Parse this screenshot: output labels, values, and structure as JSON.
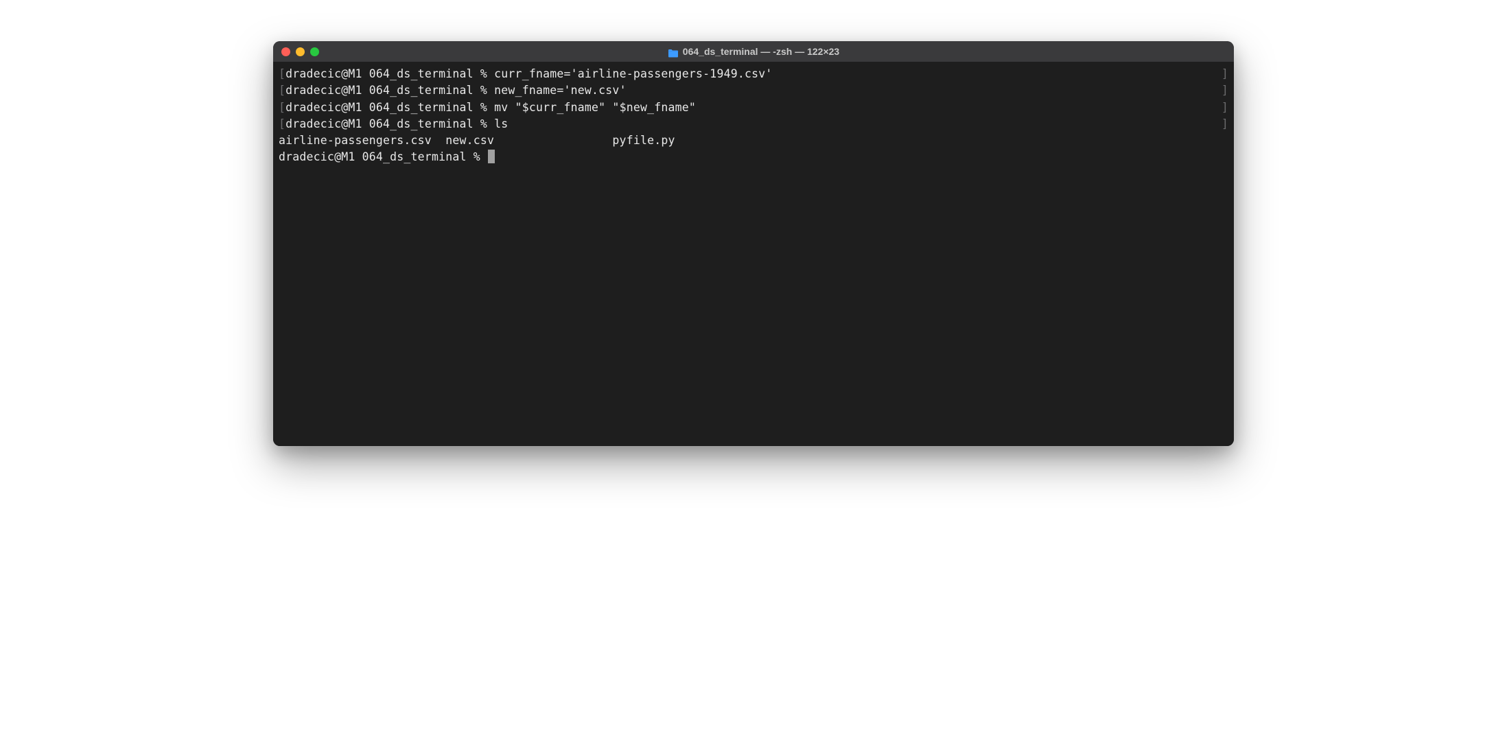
{
  "window": {
    "title": "064_ds_terminal — -zsh — 122×23"
  },
  "session": {
    "prompt": "dradecic@M1 064_ds_terminal % ",
    "bracket_open": "[",
    "bracket_close": "]",
    "history": [
      {
        "cmd": "curr_fname='airline-passengers-1949.csv'"
      },
      {
        "cmd": "new_fname='new.csv'"
      },
      {
        "cmd": "mv \"$curr_fname\" \"$new_fname\""
      },
      {
        "cmd": "ls"
      }
    ],
    "ls_output": "airline-passengers.csv  new.csv                 pyfile.py",
    "current_prompt": "dradecic@M1 064_ds_terminal % "
  }
}
